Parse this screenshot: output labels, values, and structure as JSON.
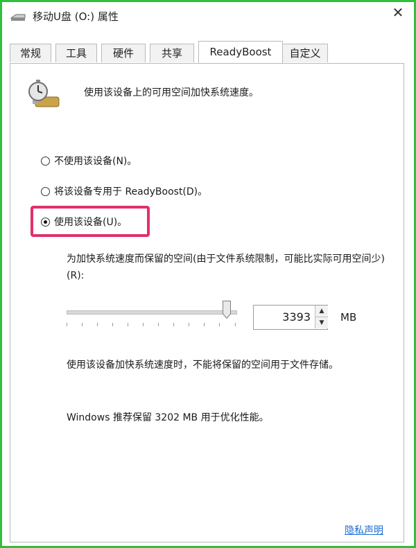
{
  "window": {
    "title": "移动U盘 (O:) 属性",
    "close": "✕"
  },
  "tabs": [
    {
      "label": "常规"
    },
    {
      "label": "工具"
    },
    {
      "label": "硬件"
    },
    {
      "label": "共享"
    },
    {
      "label": "ReadyBoost",
      "active": true
    },
    {
      "label": "自定义"
    }
  ],
  "readyboost": {
    "intro": "使用该设备上的可用空间加快系统速度。",
    "options": [
      {
        "label": "不使用该设备(N)。",
        "checked": false
      },
      {
        "label": "将该设备专用于 ReadyBoost(D)。",
        "checked": false
      },
      {
        "label": "使用该设备(U)。",
        "checked": true
      }
    ],
    "reserve_label": "为加快系统速度而保留的空间(由于文件系统限制，可能比实际可用空间少)(R):",
    "reserve_value": "3393",
    "reserve_unit": "MB",
    "slider_fraction": 0.93,
    "note": "使用该设备加快系统速度时，不能将保留的空间用于文件存储。",
    "recommend": "Windows 推荐保留 3202 MB 用于优化性能。",
    "privacy_link": "隐私声明"
  },
  "colors": {
    "frame": "#2fbf3a",
    "highlight": "#e0306a",
    "link": "#1a6bd6"
  },
  "icons": {
    "title": "drive-icon",
    "feature": "readyboost-stopwatch-icon"
  }
}
